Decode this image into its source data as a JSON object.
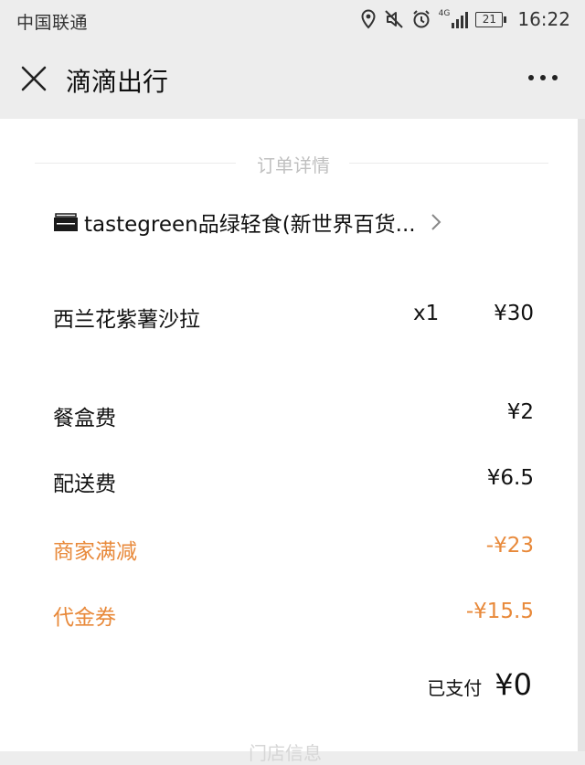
{
  "status_bar": {
    "carrier": "中国联通",
    "network": "4G",
    "battery": "21",
    "time": "16:22"
  },
  "nav": {
    "title": "滴滴出行"
  },
  "order": {
    "section_title": "订单详情",
    "shop_name": "tastegreen品绿轻食(新世界百货...",
    "items": [
      {
        "name": "西兰花紫薯沙拉",
        "qty": "x1",
        "price": "¥30"
      }
    ],
    "fees": [
      {
        "label": "餐盒费",
        "value": "¥2"
      },
      {
        "label": "配送费",
        "value": "¥6.5"
      }
    ],
    "discounts": [
      {
        "label": "商家满减",
        "value": "-¥23"
      },
      {
        "label": "代金券",
        "value": "-¥15.5"
      }
    ],
    "paid_label": "已支付",
    "paid_value": "¥0",
    "next_section_partial": "门店信息"
  },
  "colors": {
    "discount": "#e8893a",
    "nav_bg": "#ededed"
  }
}
